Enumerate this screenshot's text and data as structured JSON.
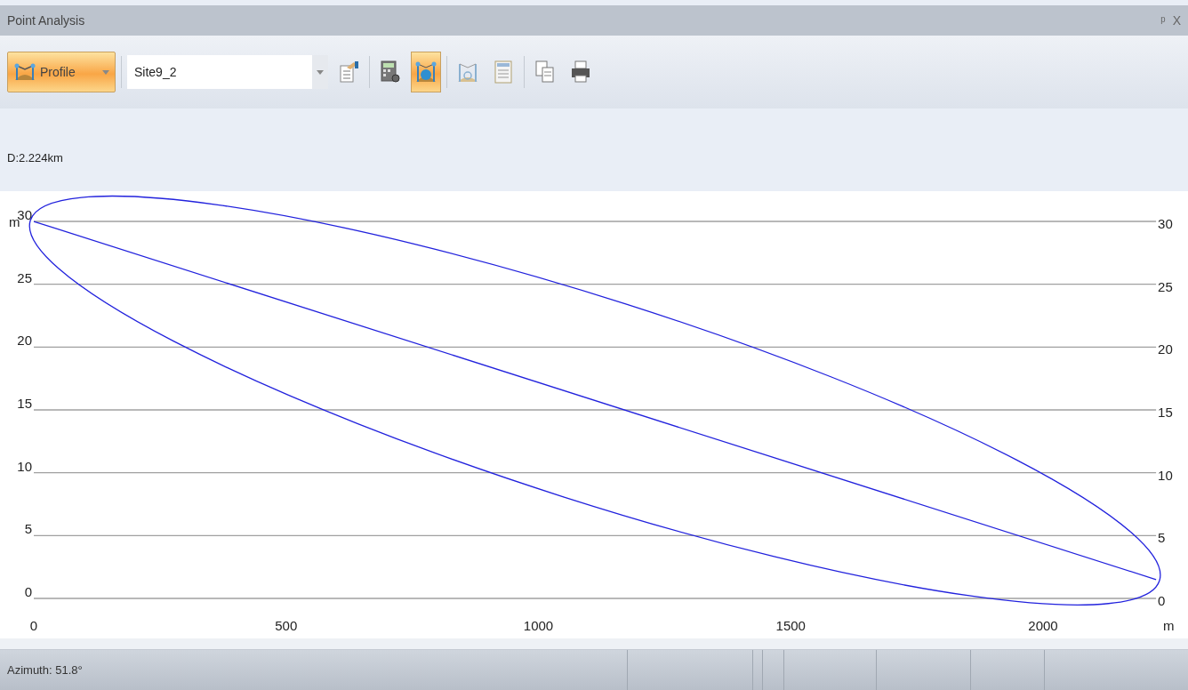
{
  "panel": {
    "title": "Point Analysis",
    "pin": "ᵖ",
    "close": "X"
  },
  "toolbar": {
    "mode_button": {
      "label": "Profile",
      "selected": true
    },
    "site_select": {
      "value": "Site9_2"
    },
    "tools": [
      {
        "kind": "properties",
        "selected": false
      },
      {
        "kind": "calculator",
        "selected": false
      },
      {
        "kind": "profile-globe",
        "selected": true
      },
      {
        "kind": "profile-tool",
        "selected": false
      },
      {
        "kind": "document",
        "selected": false
      },
      {
        "kind": "copy",
        "selected": false
      },
      {
        "kind": "print",
        "selected": false
      }
    ]
  },
  "distance": "D:2.224km",
  "chart": {
    "chart_data": {
      "type": "line",
      "xlabel": "m",
      "ylabel": "m",
      "x": [
        0,
        2224
      ],
      "series": [
        {
          "color": "#2222dd",
          "values": [
            30,
            1.5
          ]
        }
      ],
      "xlim": [
        0,
        2224
      ],
      "ylim": [
        0,
        30
      ],
      "xticks": [
        0,
        500,
        1000,
        1500,
        2000
      ],
      "yticks": [
        0,
        5,
        10,
        15,
        20,
        25,
        30
      ],
      "grid": true
    },
    "left_axis_labels": [
      "30",
      "25",
      "20",
      "15",
      "10",
      "5",
      "0"
    ],
    "right_axis_labels": [
      "30",
      "25",
      "20",
      "15",
      "10",
      "5",
      "0"
    ]
  },
  "status_bar": {
    "azimuth": "Azimuth: 51.8°"
  }
}
